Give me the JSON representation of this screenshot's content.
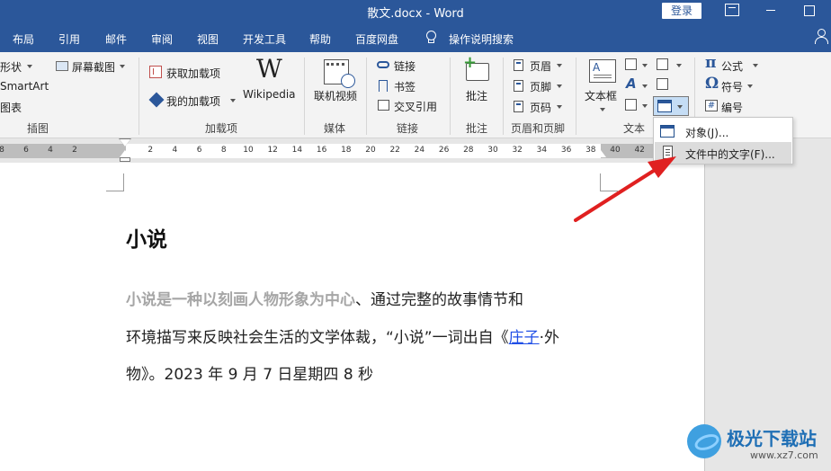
{
  "titlebar": {
    "title": "散文.docx  -  Word",
    "login": "登录"
  },
  "tabs": [
    "布局",
    "引用",
    "邮件",
    "审阅",
    "视图",
    "开发工具",
    "帮助",
    "百度网盘"
  ],
  "tell_me": "操作说明搜索",
  "ribbon": {
    "illustrations": {
      "shapes": "形状",
      "screenshot": "屏幕截图",
      "smartart": "SmartArt",
      "chart": "图表",
      "label": "插图"
    },
    "addins": {
      "get_addins": "获取加载项",
      "my_addins": "我的加载项",
      "wikipedia": "Wikipedia",
      "label": "加载项"
    },
    "media": {
      "online_video": "联机视频",
      "label": "媒体"
    },
    "links": {
      "link": "链接",
      "bookmark": "书签",
      "cross_ref": "交叉引用",
      "label": "链接"
    },
    "comments": {
      "comment": "批注",
      "label": "批注"
    },
    "header_footer": {
      "header": "页眉",
      "footer": "页脚",
      "page_number": "页码",
      "label": "页眉和页脚"
    },
    "text": {
      "textbox": "文本框",
      "label": "文本"
    },
    "symbols": {
      "equation": "公式",
      "symbol": "符号",
      "number": "编号"
    }
  },
  "ruler_numbers": [
    "8",
    "6",
    "4",
    "2",
    "2",
    "4",
    "6",
    "8",
    "10",
    "12",
    "14",
    "16",
    "18",
    "20",
    "22",
    "24",
    "26",
    "28",
    "30",
    "32",
    "34",
    "36",
    "38",
    "40",
    "42"
  ],
  "document": {
    "heading": "小说",
    "line1_highlight": "小说是一种以刻画人物形象为中心",
    "line1_rest": "、通过完整的故事情节和",
    "line2_pre": "环境描写来反映社会生活的文学体裁，“小说”一词出自《",
    "line2_link": "庄子",
    "line2_post": "·外",
    "line3": "物》。2023 年 9 月 7 日星期四 8 秒"
  },
  "dropdown": {
    "items": [
      "对象(J)...",
      "文件中的文字(F)..."
    ]
  },
  "watermark": {
    "name": "极光下载站",
    "url": "www.xz7.com"
  },
  "colors": {
    "accent": "#2b579a",
    "arrow": "#e02020",
    "link": "#1f4ee6"
  }
}
